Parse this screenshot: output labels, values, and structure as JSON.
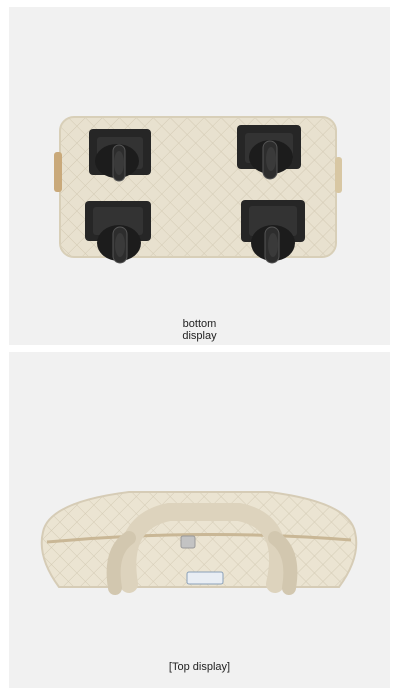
{
  "panels": [
    {
      "caption_lines": [
        "bottom",
        "display"
      ]
    },
    {
      "caption": "[Top display]"
    }
  ],
  "colors": {
    "background": "#f1f1f1",
    "bag_fabric": "#e7e0ce",
    "wheel": "#1e1e1e"
  },
  "icons": [
    "wheel-icon",
    "zipper-icon",
    "handle-icon",
    "label-tag-icon"
  ]
}
